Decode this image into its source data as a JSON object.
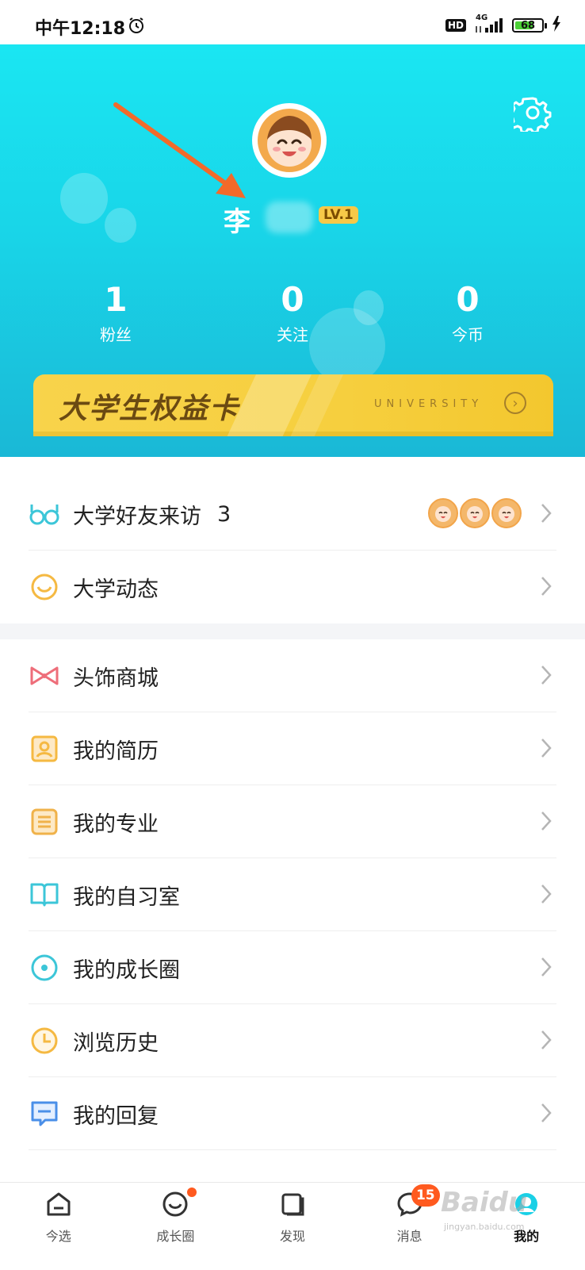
{
  "status_bar": {
    "time": "中午12:18",
    "hd": "HD",
    "network": "4G",
    "battery": "68"
  },
  "profile": {
    "name": "李",
    "level": "LV.1",
    "stats": [
      {
        "value": "1",
        "label": "粉丝"
      },
      {
        "value": "0",
        "label": "关注"
      },
      {
        "value": "0",
        "label": "今币"
      }
    ]
  },
  "card": {
    "title": "大学生权益卡",
    "subtitle": "UNIVERSITY"
  },
  "section1": [
    {
      "label": "大学好友来访",
      "count": "3",
      "icon": "glasses-icon"
    },
    {
      "label": "大学动态",
      "icon": "smile-icon"
    }
  ],
  "section2": [
    {
      "label": "头饰商城",
      "icon": "bow-icon"
    },
    {
      "label": "我的简历",
      "icon": "resume-icon"
    },
    {
      "label": "我的专业",
      "icon": "major-icon"
    },
    {
      "label": "我的自习室",
      "icon": "book-icon"
    },
    {
      "label": "我的成长圈",
      "icon": "circle-icon"
    },
    {
      "label": "浏览历史",
      "icon": "clock-icon"
    },
    {
      "label": "我的回复",
      "icon": "message-icon"
    }
  ],
  "bottom_nav": [
    {
      "label": "今选",
      "icon": "home-icon"
    },
    {
      "label": "成长圈",
      "icon": "growth-icon"
    },
    {
      "label": "发现",
      "icon": "discover-icon"
    },
    {
      "label": "消息",
      "icon": "chat-icon",
      "badge": "15"
    },
    {
      "label": "我的",
      "icon": "profile-icon"
    }
  ],
  "watermark": {
    "brand": "Baidu",
    "url": "jingyan.baidu.com"
  },
  "colors": {
    "header_top": "#1ae6f2",
    "header_bottom": "#1ab8d6",
    "card": "#f6cf3e",
    "badge": "#ff5a1f",
    "arrow": "#f26a2a"
  }
}
